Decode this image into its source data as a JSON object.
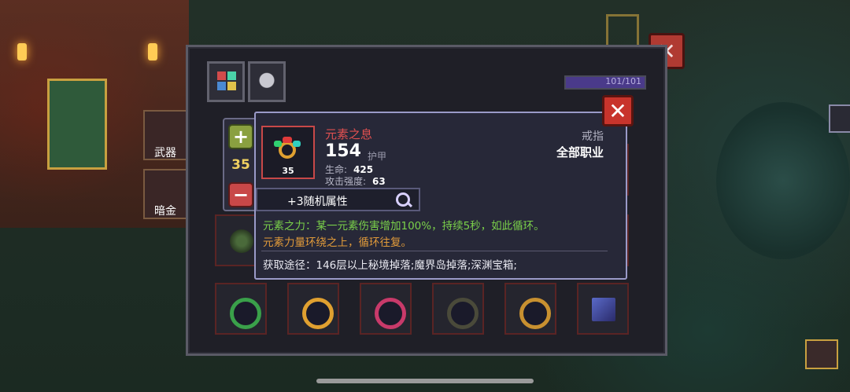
{
  "inventory": {
    "capacity_text": "101/101",
    "capacity_fraction": 1.0,
    "tabs": [
      {
        "icon": "item-grid-icon"
      },
      {
        "icon": "demon-helmet-icon"
      }
    ]
  },
  "side_buttons": {
    "weapon_label": "武器",
    "gold_label": "暗金"
  },
  "level_adjuster": {
    "plus": "+",
    "minus": "−",
    "value": "35"
  },
  "item": {
    "name": "元素之息",
    "level": "35",
    "power": "154",
    "power_label": "护甲",
    "type": "戒指",
    "class_restriction": "全部职业",
    "stats": [
      {
        "label": "生命:",
        "value": "425"
      },
      {
        "label": "攻击强度:",
        "value": "63"
      }
    ],
    "random_attr_label": "+3随机属性",
    "effect_text": "元素之力：某一元素伤害增加100%，持续5秒，如此循环。",
    "flavor_text": "元素力量环绕之上，循环往复。",
    "source_text": "获取途径：146层以上秘境掉落;魔界岛掉落;深渊宝箱;",
    "colors": {
      "name": "#e05050",
      "effect": "#7ad04a",
      "flavor": "#e09a3a"
    }
  },
  "close_symbol": "✕"
}
